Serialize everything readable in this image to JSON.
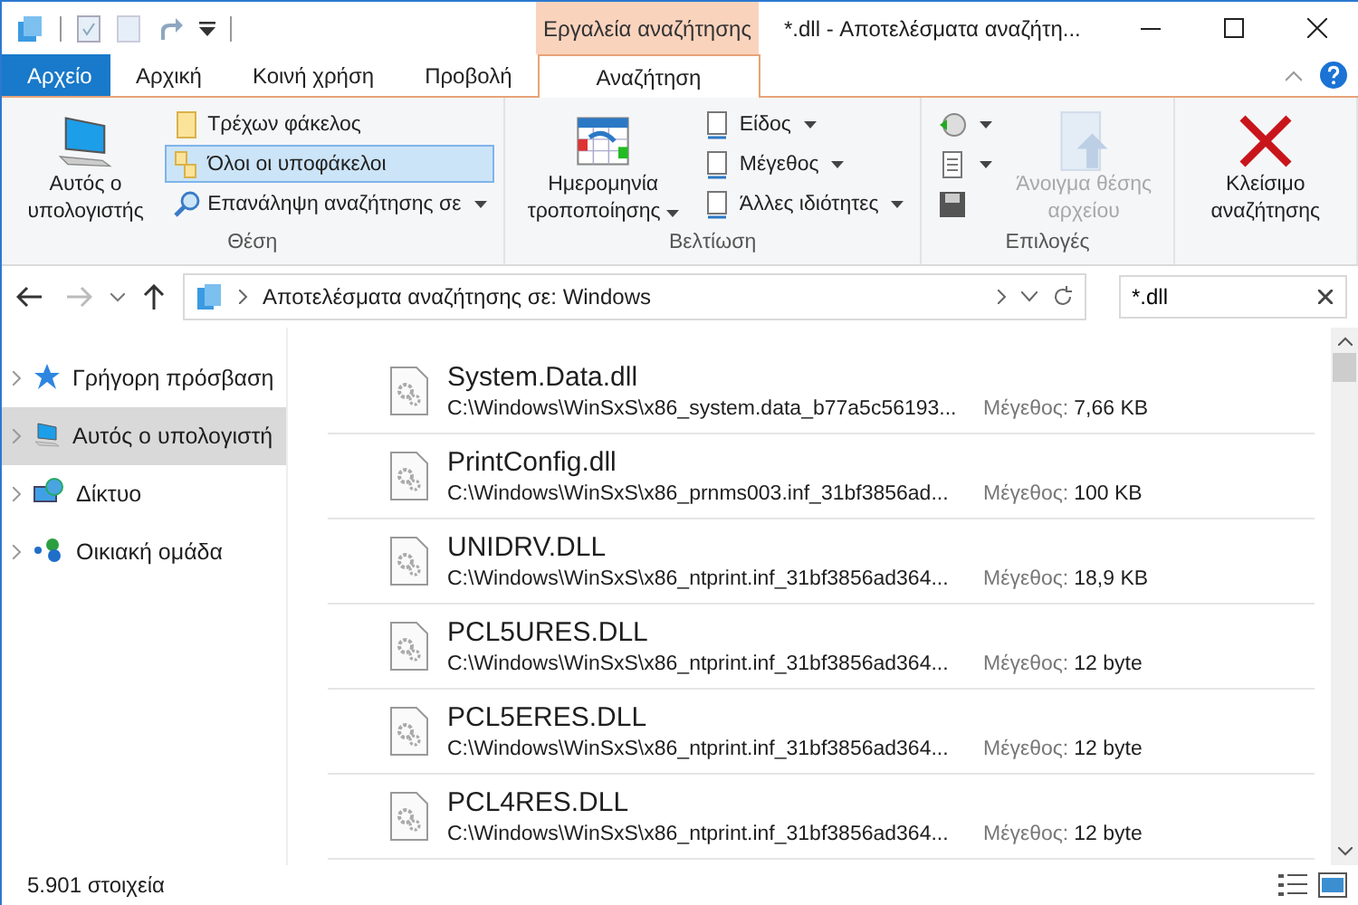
{
  "window": {
    "title": "*.dll - Αποτελέσματα αναζήτη..."
  },
  "contextual_group": "Εργαλεία αναζήτησης",
  "tabs": [
    {
      "label": "Αρχείο",
      "kind": "file",
      "selected": false
    },
    {
      "label": "Αρχική",
      "kind": "tab",
      "selected": false
    },
    {
      "label": "Κοινή χρήση",
      "kind": "tab",
      "selected": false
    },
    {
      "label": "Προβολή",
      "kind": "tab",
      "selected": false
    },
    {
      "label": "Αναζήτηση",
      "kind": "contextual",
      "selected": true
    }
  ],
  "ribbon_groups": [
    {
      "label": "Θέση",
      "items": [
        {
          "kind": "big",
          "label": "Αυτός ο υπολογιστής",
          "dropdown": false,
          "disabled": false
        },
        {
          "kind": "small",
          "label": "Τρέχων φάκελος",
          "dropdown": false,
          "selected": false
        },
        {
          "kind": "small",
          "label": "Όλοι οι υποφάκελοι",
          "dropdown": false,
          "selected": true
        },
        {
          "kind": "small",
          "label": "Επανάληψη αναζήτησης σε",
          "dropdown": true,
          "selected": false
        }
      ]
    },
    {
      "label": "Βελτίωση",
      "items": [
        {
          "kind": "big",
          "label": "Ημερομηνία τροποποίησης",
          "dropdown": true,
          "disabled": false
        },
        {
          "kind": "small",
          "label": "Είδος",
          "dropdown": true,
          "selected": false
        },
        {
          "kind": "small",
          "label": "Μέγεθος",
          "dropdown": true,
          "selected": false
        },
        {
          "kind": "small",
          "label": "Άλλες ιδιότητες",
          "dropdown": true,
          "selected": false
        }
      ]
    },
    {
      "label": "Επιλογές",
      "items": [
        {
          "kind": "icon",
          "dropdown": true
        },
        {
          "kind": "icon",
          "dropdown": true
        },
        {
          "kind": "icon",
          "dropdown": false
        },
        {
          "kind": "big",
          "label": "Άνοιγμα θέσης αρχείου",
          "dropdown": false,
          "disabled": true
        }
      ]
    },
    {
      "items": [
        {
          "kind": "big",
          "label": "Κλείσιμο αναζήτησης",
          "dropdown": false,
          "disabled": false
        }
      ]
    }
  ],
  "address_bar": {
    "path": "Αποτελέσματα αναζήτησης σε: Windows"
  },
  "search": {
    "value": "*.dll"
  },
  "navigation": [
    {
      "label": "Γρήγορη πρόσβαση",
      "selected": false
    },
    {
      "label": "Αυτός ο υπολογιστή",
      "selected": true
    },
    {
      "label": "Δίκτυο",
      "selected": false
    },
    {
      "label": "Οικιακή ομάδα",
      "selected": false
    }
  ],
  "files": [
    {
      "name": "System.Data.dll",
      "path": "C:\\Windows\\WinSxS\\x86_system.data_b77a5c56193...",
      "size_label": "Μέγεθος:",
      "size": "7,66 KB"
    },
    {
      "name": "PrintConfig.dll",
      "path": "C:\\Windows\\WinSxS\\x86_prnms003.inf_31bf3856ad...",
      "size_label": "Μέγεθος:",
      "size": "100 KB"
    },
    {
      "name": "UNIDRV.DLL",
      "path": "C:\\Windows\\WinSxS\\x86_ntprint.inf_31bf3856ad364...",
      "size_label": "Μέγεθος:",
      "size": "18,9 KB"
    },
    {
      "name": "PCL5URES.DLL",
      "path": "C:\\Windows\\WinSxS\\x86_ntprint.inf_31bf3856ad364...",
      "size_label": "Μέγεθος:",
      "size": "12 byte"
    },
    {
      "name": "PCL5ERES.DLL",
      "path": "C:\\Windows\\WinSxS\\x86_ntprint.inf_31bf3856ad364...",
      "size_label": "Μέγεθος:",
      "size": "12 byte"
    },
    {
      "name": "PCL4RES.DLL",
      "path": "C:\\Windows\\WinSxS\\x86_ntprint.inf_31bf3856ad364...",
      "size_label": "Μέγεθος:",
      "size": "12 byte"
    }
  ],
  "status_bar": {
    "count": "5.901 στοιχεία"
  }
}
